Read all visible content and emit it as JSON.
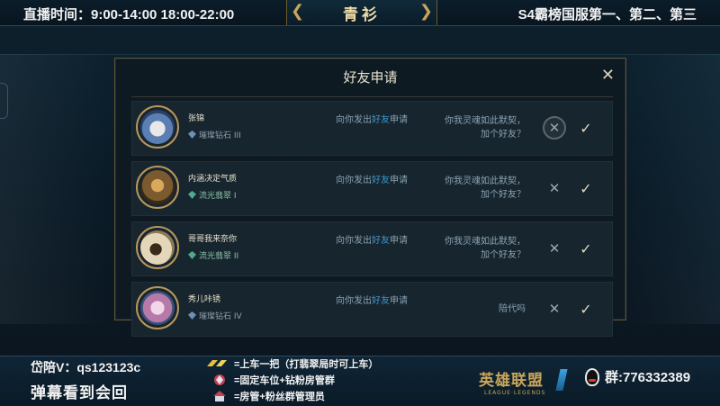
{
  "topbar": {
    "schedule": "直播时间：9:00-14:00  18:00-22:00",
    "streamer_name": "青衫",
    "rank_text": "S4霸榜国服第一、第二、第三"
  },
  "dialog": {
    "title": "好友申请",
    "close_label": "✕",
    "requests": [
      {
        "name": "张锦",
        "rank": "璀璨钻石 III",
        "request_prefix": "向你发出",
        "request_highlight": "好友",
        "request_suffix": "申请",
        "message_line1": "你我灵魂如此默契，",
        "message_line2": "加个好友？",
        "avatar_color": "#5b7fb3",
        "rank_color": "#6f8fb6"
      },
      {
        "name": "内涵决定气质",
        "rank": "流光翡翠 I",
        "request_prefix": "向你发出",
        "request_highlight": "好友",
        "request_suffix": "申请",
        "message_line1": "你我灵魂如此默契，",
        "message_line2": "加个好友？",
        "avatar_color": "#7a5a2e",
        "rank_color": "#4fa98a"
      },
      {
        "name": "哥哥我来奈你",
        "rank": "流光翡翠 II",
        "request_prefix": "向你发出",
        "request_highlight": "好友",
        "request_suffix": "申请",
        "message_line1": "你我灵魂如此默契，",
        "message_line2": "加个好友？",
        "avatar_color": "#8c7a55",
        "rank_color": "#4fa98a"
      },
      {
        "name": "秀儿咔锈",
        "rank": "璀璨钻石 IV",
        "request_prefix": "向你发出",
        "request_highlight": "好友",
        "request_suffix": "申请",
        "message_line1": "陪代吗",
        "message_line2": "",
        "avatar_color": "#b77aa8",
        "rank_color": "#6f8fb6"
      }
    ],
    "decline_label": "✕",
    "accept_label": "✓"
  },
  "bottombar": {
    "wechat": "岱陪V：qs123123c",
    "danmu": "弹幕看到会回",
    "perk_lines": [
      "=上车一把（打翡翠局时可上车）",
      "=固定车位+钻粉房管群",
      "=房管+粉丝群管理员"
    ],
    "lol_cn": "英雄联盟",
    "lol_en": "LEAGUE·LEGENDS",
    "qq_group": "群:776332389"
  }
}
